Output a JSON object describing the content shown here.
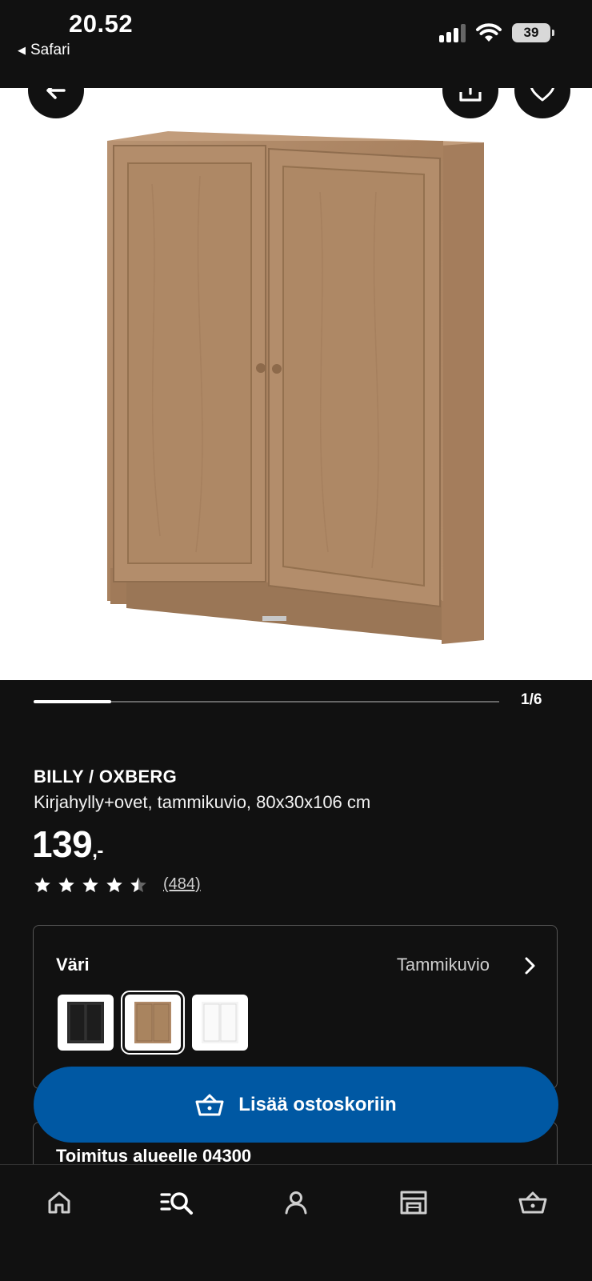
{
  "status_bar": {
    "time": "20.52",
    "back_app": "Safari",
    "battery": "39",
    "icons": [
      "cellular-signal-icon",
      "wifi-icon",
      "battery-icon"
    ]
  },
  "gallery": {
    "current": "1/6",
    "progress_fraction": 0.1667,
    "icons": [
      "back-arrow-icon",
      "share-icon",
      "heart-icon"
    ]
  },
  "product": {
    "name": "BILLY / OXBERG",
    "description": "Kirjahylly+ovet, tammikuvio, 80x30x106 cm",
    "price": "139",
    "price_suffix": ",-",
    "rating": 4.5,
    "review_count": "(484)"
  },
  "color_picker": {
    "label": "Väri",
    "selected_value": "Tammikuvio",
    "swatches": [
      "black",
      "oak",
      "white"
    ],
    "selected_index": 1
  },
  "cart_button": {
    "label": "Lisää ostoskoriin",
    "color": "#0058a3"
  },
  "delivery": {
    "label": "Toimitus alueelle 04300"
  },
  "tabbar": {
    "icons": [
      "home-icon",
      "search-list-icon",
      "profile-icon",
      "store-icon",
      "cart-icon"
    ],
    "active_index": 1
  }
}
